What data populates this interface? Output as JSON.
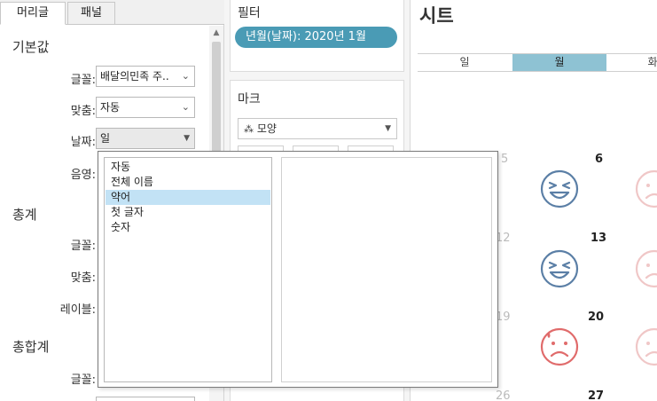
{
  "format_pane": {
    "tabs": [
      "머리글",
      "패널"
    ],
    "sections": {
      "default": "기본값",
      "total": "총계",
      "grand_total": "총합계"
    },
    "labels": {
      "font": "글꼴:",
      "align": "맞춤:",
      "date": "날짜:",
      "shading": "음영:",
      "font2": "글꼴:",
      "align2": "맞춤:",
      "label2": "레이블:",
      "font3": "글꼴:"
    },
    "values": {
      "font": "배달의민족 주..",
      "align": "자동",
      "date": "일"
    }
  },
  "shelves": {
    "filter_title": "필터",
    "filter_pill": "년월(날짜): 2020년 1월",
    "marks_title": "마크",
    "mark_type": "모양"
  },
  "view": {
    "sheet_title": "시트",
    "day_headers": [
      "일",
      "월",
      "화"
    ],
    "dates": [
      "5",
      "6",
      "12",
      "13",
      "19",
      "20",
      "26",
      "27"
    ]
  },
  "date_format_popup": {
    "options": [
      "자동",
      "전체 이름",
      "약어",
      "첫 글자",
      "숫자"
    ],
    "selected_index": 2
  },
  "colors": {
    "accent": "#4a9bb5",
    "header_selected": "#8ec2d3",
    "face_blue": "#5b7fa6",
    "face_red": "#e06b6b",
    "face_pale": "#f0c7c7",
    "list_selected": "#c2e2f5"
  },
  "icons": [
    "chevron-down-icon",
    "caret-down-icon",
    "scroll-up-icon",
    "shape-mark-icon",
    "laugh-face-icon",
    "sad-sweat-face-icon"
  ]
}
